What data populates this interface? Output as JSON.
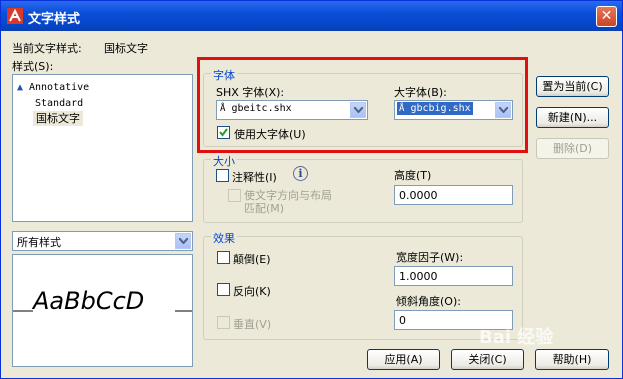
{
  "window": {
    "title": "文字样式",
    "close": "✕"
  },
  "current_style": {
    "label": "当前文字样式:",
    "value": "国标文字"
  },
  "styles": {
    "label": "样式(S):",
    "items": [
      "Annotative",
      "Standard",
      "国标文字"
    ],
    "filter": "所有样式"
  },
  "preview": {
    "text": "AaBbCcD"
  },
  "font_group": {
    "title": "字体",
    "shx_label": "SHX 字体(X):",
    "shx_value": "gbeitc.shx",
    "big_label": "大字体(B):",
    "big_value": "gbcbig.shx",
    "use_bigfont": "使用大字体(U)",
    "use_bigfont_checked": true
  },
  "size_group": {
    "title": "大小",
    "annotative": "注释性(I)",
    "match_orientation_1": "使文字方向与布局",
    "match_orientation_2": "匹配(M)",
    "height_label": "高度(T)",
    "height_value": "0.0000"
  },
  "effects_group": {
    "title": "效果",
    "upside_down": "颠倒(E)",
    "backwards": "反向(K)",
    "vertical": "垂直(V)",
    "width_label": "宽度因子(W):",
    "width_value": "1.0000",
    "oblique_label": "倾斜角度(O):",
    "oblique_value": "0"
  },
  "buttons": {
    "set_current": "置为当前(C)",
    "new": "新建(N)...",
    "delete": "删除(D)",
    "apply": "应用(A)",
    "close": "关闭(C)",
    "help": "帮助(H)"
  },
  "watermark": "Bai 经验"
}
